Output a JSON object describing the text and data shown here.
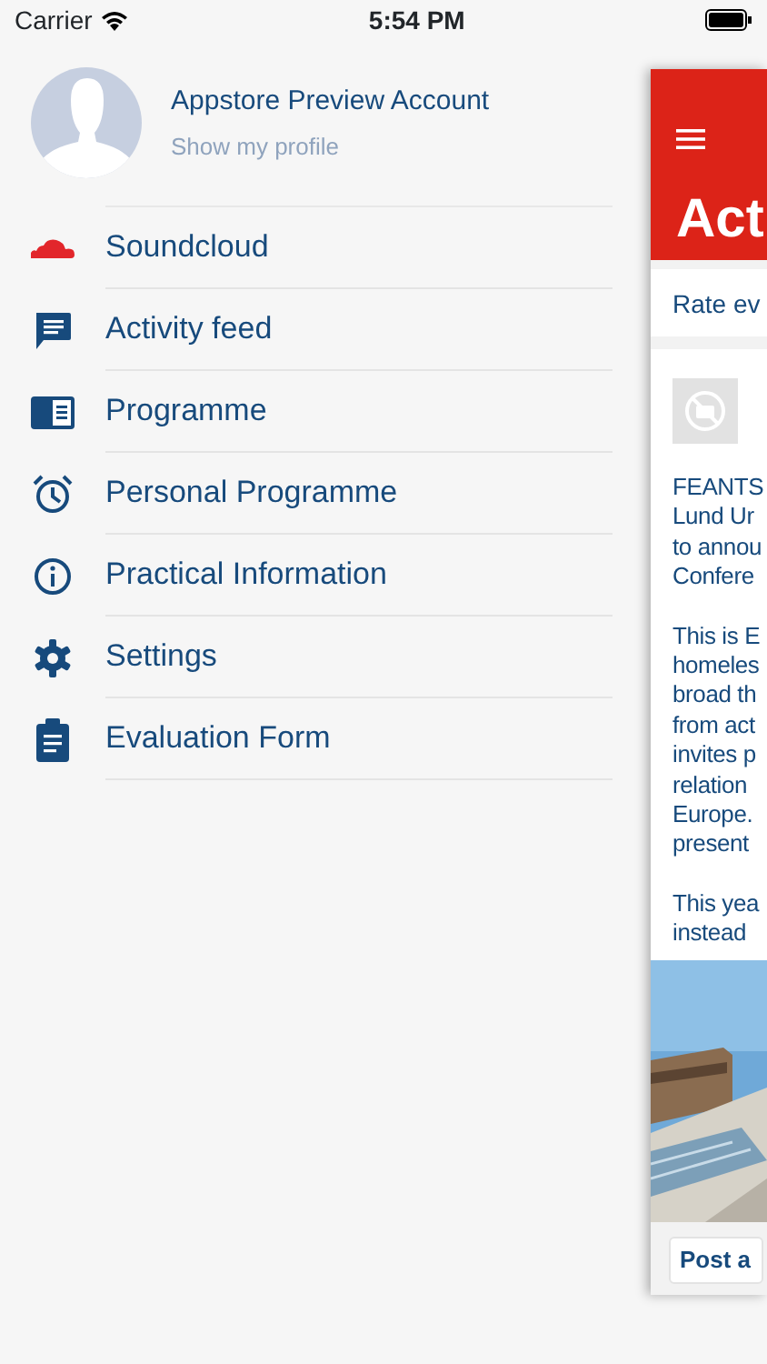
{
  "status_bar": {
    "carrier": "Carrier",
    "time": "5:54 PM"
  },
  "profile": {
    "name": "Appstore Preview Account",
    "link": "Show my profile"
  },
  "menu": [
    {
      "label": "Soundcloud",
      "kind": "cloud"
    },
    {
      "label": "Activity feed",
      "kind": "chat"
    },
    {
      "label": "Programme",
      "kind": "book"
    },
    {
      "label": "Personal Programme",
      "kind": "alarm"
    },
    {
      "label": "Practical Information",
      "kind": "info"
    },
    {
      "label": "Settings",
      "kind": "gear"
    },
    {
      "label": "Evaluation Form",
      "kind": "clipboard"
    }
  ],
  "panel": {
    "title": "Act",
    "subheader": "Rate ev",
    "paragraphs": [
      [
        "FEANTS",
        "Lund Ur",
        "to annou",
        "Confere"
      ],
      [
        "This is E",
        "homeles",
        "broad th",
        "from act",
        "invites p",
        "relation",
        "Europe.",
        "present"
      ],
      [
        "This yea",
        "instead"
      ]
    ],
    "image": {
      "kind": "picture"
    },
    "button": "Post a"
  }
}
